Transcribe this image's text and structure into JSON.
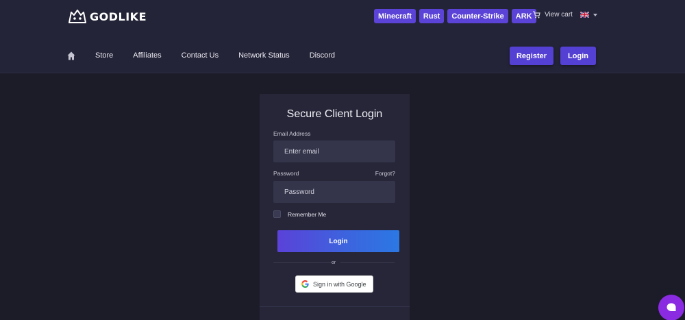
{
  "header": {
    "logo_text": "GODLIKE",
    "game_tags": [
      "Minecraft",
      "Rust",
      "Counter-Strike",
      "ARK"
    ],
    "cart_label": "View cart",
    "language": "en-GB",
    "nav_items": [
      "Store",
      "Affiliates",
      "Contact Us",
      "Network Status",
      "Discord"
    ],
    "register_label": "Register",
    "login_label": "Login"
  },
  "login": {
    "title": "Secure Client Login",
    "email_label": "Email Address",
    "email_placeholder": "Enter email",
    "password_label": "Password",
    "password_placeholder": "Password",
    "forgot_label": "Forgot?",
    "remember_label": "Remember Me",
    "submit_label": "Login",
    "or_text": "or",
    "google_label": "Sign in with Google"
  },
  "icons": {
    "home": "home-icon",
    "cart": "cart-icon",
    "flag": "uk-flag-icon",
    "google": "google-icon",
    "chat": "chat-icon"
  },
  "colors": {
    "accent": "#5540d4",
    "background": "#1c1b28",
    "header": "#242438",
    "card": "#262638",
    "chat": "#8a2be2"
  }
}
